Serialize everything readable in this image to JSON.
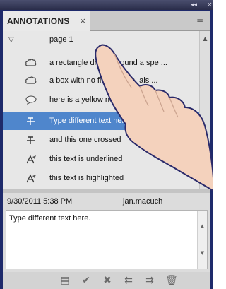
{
  "window": {
    "controls": [
      "◂◂",
      "|",
      "×"
    ]
  },
  "panel": {
    "tab_title": "ANNOTATIONS",
    "tab_close": "×",
    "menu_icon": "≡"
  },
  "tree": {
    "page_label": "page 1",
    "items": [
      {
        "label": "a rectangle drawn around a spe ...",
        "icon": "cloud-icon"
      },
      {
        "label": "a box with no fill, corners, als ...",
        "icon": "cloud-icon"
      },
      {
        "label": "here is a yellow note",
        "icon": "speech-bubble-icon"
      },
      {
        "label": "Type different text here.",
        "icon": "strikeout-icon",
        "selected": true
      },
      {
        "label": "and this one crossed",
        "icon": "strikeout-icon"
      },
      {
        "label": "this text is underlined",
        "icon": "highlight-icon"
      },
      {
        "label": "this text is highlighted",
        "icon": "highlight-icon"
      }
    ]
  },
  "details": {
    "date": "9/30/2011 5:38 PM",
    "author": "jan.macuch",
    "comment": "Type different text here."
  },
  "toolbar": {
    "buttons": [
      {
        "name": "note-tool-icon",
        "glyph": "▤"
      },
      {
        "name": "checkmark-icon",
        "glyph": "✔"
      },
      {
        "name": "cross-icon",
        "glyph": "✖"
      },
      {
        "name": "previous-annotation-icon",
        "glyph": "⇇"
      },
      {
        "name": "next-annotation-icon",
        "glyph": "⇉"
      },
      {
        "name": "trash-icon",
        "glyph": "🗑"
      }
    ]
  },
  "colors": {
    "panel_bg": "#1e2a6b",
    "selection": "#4f86cc",
    "list_bg": "#e7e7e7"
  }
}
